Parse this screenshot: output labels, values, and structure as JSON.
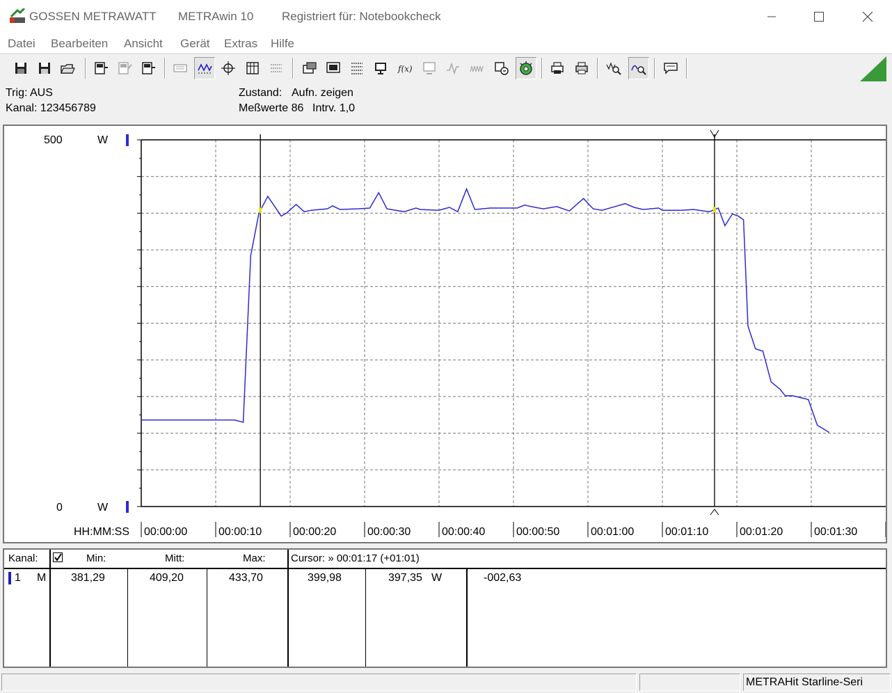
{
  "window": {
    "brand": "GOSSEN METRAWATT",
    "app": "METRAwin 10",
    "registered": "Registriert für: Notebookcheck"
  },
  "menu": [
    "Datei",
    "Bearbeiten",
    "Ansicht",
    "Gerät",
    "Extras",
    "Hilfe"
  ],
  "toolbar": {
    "icons": [
      "save-icon",
      "save-as-icon",
      "open-folder-icon",
      "device-read-icon",
      "device-disabled-icon",
      "device-write-icon",
      "keyboard-disabled-icon",
      "waveform-view-icon",
      "crosshair-icon",
      "table-view-icon",
      "list-view-icon",
      "window-view-icon",
      "screen-icon",
      "grid-icon",
      "monitor-icon",
      "formula-icon",
      "display-disabled-icon",
      "signal-disabled-icon",
      "signal-peaks-disabled-icon",
      "scan-icon",
      "record-gauge-icon",
      "printer-icon",
      "print-icon",
      "zoom-wave-icon",
      "zoom-curve-icon",
      "chat-icon"
    ]
  },
  "info": {
    "trig": "Trig: AUS",
    "kanal": "Kanal: 123456789",
    "zustand_label": "Zustand:",
    "zustand_value": "Aufn. zeigen",
    "messwerte": "Meßwerte 86",
    "intervall": "Intrv. 1,0"
  },
  "chart": {
    "y_top": "500",
    "y_bottom": "0",
    "unit": "W",
    "x_axis_label": "HH:MM:SS",
    "x_ticks": [
      "00:00:00",
      "00:00:10",
      "00:00:20",
      "00:00:30",
      "00:00:40",
      "00:00:50",
      "00:01:00",
      "00:01:10",
      "00:01:20",
      "00:01:30"
    ],
    "line_color": "#2b2bd6"
  },
  "chart_data": {
    "type": "line",
    "title": "",
    "xlabel": "HH:MM:SS",
    "ylabel": "W",
    "xlim": [
      0,
      100
    ],
    "ylim": [
      0,
      500
    ],
    "grid": true,
    "cursors": [
      16,
      77
    ],
    "series": [
      {
        "values": [
          [
            0,
            118
          ],
          [
            12.5,
            118
          ],
          [
            13.7,
            115
          ],
          [
            14.7,
            342
          ],
          [
            15.8,
            400
          ],
          [
            17,
            423
          ],
          [
            18.8,
            396
          ],
          [
            19.5,
            400
          ],
          [
            20.8,
            412
          ],
          [
            21.9,
            402
          ],
          [
            22.8,
            404
          ],
          [
            25,
            406
          ],
          [
            25.7,
            410
          ],
          [
            26.7,
            405
          ],
          [
            29.1,
            406
          ],
          [
            30.7,
            407
          ],
          [
            31.9,
            428
          ],
          [
            33,
            406
          ],
          [
            35.3,
            402
          ],
          [
            36.9,
            407
          ],
          [
            37.5,
            405
          ],
          [
            40,
            404
          ],
          [
            41.4,
            408
          ],
          [
            42.5,
            402
          ],
          [
            43.7,
            433
          ],
          [
            44.8,
            405
          ],
          [
            46.9,
            407
          ],
          [
            50.5,
            407
          ],
          [
            51.5,
            411
          ],
          [
            52.9,
            408
          ],
          [
            54,
            406
          ],
          [
            55.8,
            409
          ],
          [
            57.5,
            403
          ],
          [
            59.4,
            420
          ],
          [
            60.7,
            406
          ],
          [
            61.9,
            404
          ],
          [
            65,
            413
          ],
          [
            66.2,
            408
          ],
          [
            67.4,
            405
          ],
          [
            69.5,
            407
          ],
          [
            70,
            404
          ],
          [
            72.5,
            404
          ],
          [
            74.2,
            405
          ],
          [
            76.3,
            402
          ],
          [
            77.5,
            407
          ],
          [
            78.4,
            383
          ],
          [
            79.4,
            399
          ],
          [
            80.2,
            396
          ],
          [
            80.9,
            391
          ],
          [
            81.5,
            246
          ],
          [
            82.5,
            215
          ],
          [
            83.5,
            212
          ],
          [
            84.6,
            170
          ],
          [
            85.8,
            160
          ],
          [
            86.5,
            151
          ],
          [
            87.5,
            151
          ],
          [
            89.6,
            146
          ],
          [
            90.8,
            111
          ],
          [
            92.4,
            101
          ]
        ]
      }
    ]
  },
  "table": {
    "kanal_header": "Kanal:",
    "min_header": "Min:",
    "mitt_header": "Mitt:",
    "max_header": "Max:",
    "cursor_header": "Cursor: » 00:01:17 (+01:01)",
    "row": {
      "channel": "1",
      "mode": "M",
      "min": "381,29",
      "mitt": "409,20",
      "max": "433,70",
      "cursor1": "399,98",
      "cursor2": "397,35",
      "unit": "W",
      "delta": "-002,63"
    }
  },
  "status": {
    "device": "METRAHit Starline-Seri"
  }
}
